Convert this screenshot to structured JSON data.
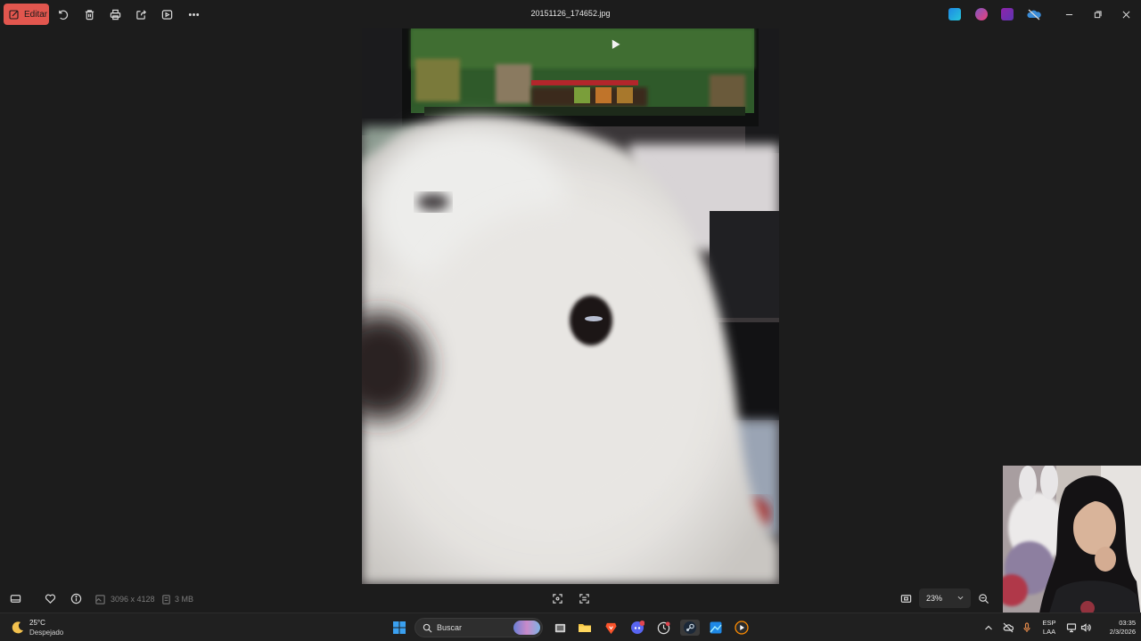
{
  "toolbar": {
    "edit_label": "Editar",
    "filename": "20151126_174652.jpg",
    "accent": "#e2564e"
  },
  "infobar": {
    "dimensions": "3096 x 4128",
    "filesize": "3 MB",
    "zoom": "23%"
  },
  "taskbar": {
    "weather_temp": "25°C",
    "weather_cond": "Despejado",
    "search_placeholder": "Buscar",
    "lang_line1": "ESP",
    "lang_line2": "LAA",
    "time": "03:35",
    "date": "2/3/2026"
  },
  "icons": {
    "toolbar": [
      "rotate-icon",
      "delete-icon",
      "print-icon",
      "share-icon",
      "slideshow-icon",
      "more-icon"
    ],
    "apps": [
      "app-icon-1",
      "app-icon-2",
      "app-icon-3",
      "onedrive-icon"
    ],
    "taskbar": [
      "windows-start-icon",
      "task-view-icon",
      "file-explorer-icon",
      "brave-icon",
      "discord-icon",
      "clock-app-icon",
      "steam-icon",
      "photos-icon",
      "media-player-icon"
    ]
  }
}
